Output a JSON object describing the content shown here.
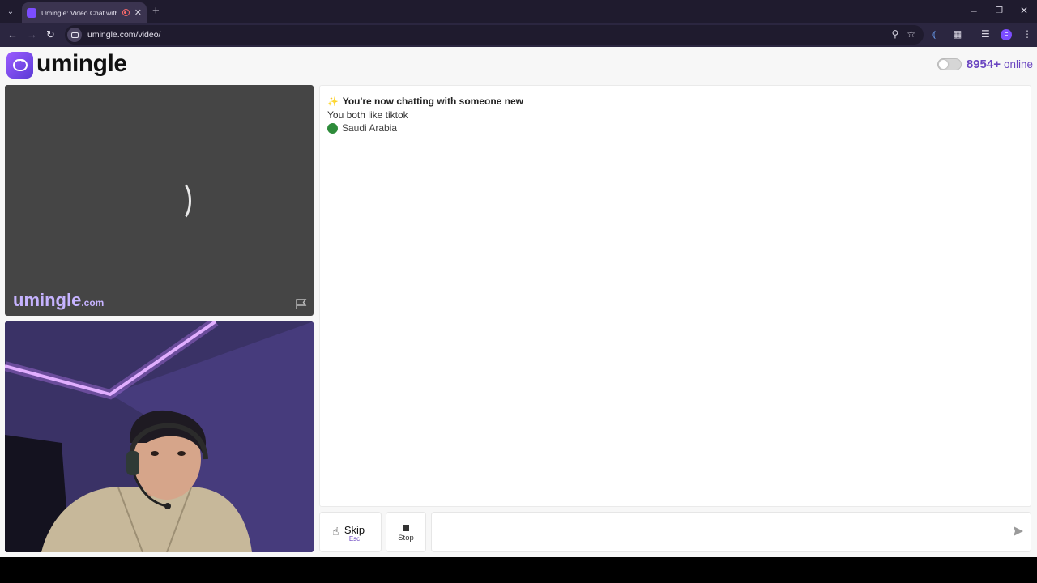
{
  "browser": {
    "tab_title": "Umingle: Video Chat with Strangers",
    "url": "umingle.com/video/",
    "profile_initial": "F"
  },
  "header": {
    "logo_text": "umingle",
    "online_count": "8954+",
    "online_label": "online"
  },
  "stranger_video": {
    "watermark_main": "umingle",
    "watermark_suffix": ".com"
  },
  "chat": {
    "status_title": "You're now chatting with someone new",
    "common_interest": "You both like tiktok",
    "country": "Saudi Arabia",
    "input_placeholder": ""
  },
  "controls": {
    "skip_label": "Skip",
    "skip_key": "Esc",
    "stop_label": "Stop"
  },
  "colors": {
    "brand": "#6b46c1",
    "accent": "#7c4dff"
  }
}
